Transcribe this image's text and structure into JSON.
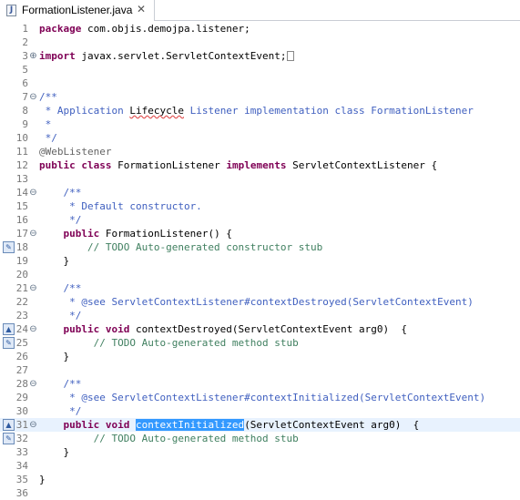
{
  "tab": {
    "title": "FormationListener.java",
    "close": "✕"
  },
  "lines": [
    {
      "n": "1",
      "marker": "",
      "code": [
        [
          "k",
          "package"
        ],
        [
          "t",
          " com.objis.demojpa.listener;"
        ]
      ]
    },
    {
      "n": "2",
      "marker": "",
      "code": []
    },
    {
      "n": "3",
      "marker": "fold-expand",
      "code": [
        [
          "k",
          "import"
        ],
        [
          "t",
          " javax.servlet.ServletContextEvent;"
        ],
        [
          "box",
          ""
        ]
      ]
    },
    {
      "n": "5",
      "marker": "",
      "code": []
    },
    {
      "n": "6",
      "marker": "",
      "code": []
    },
    {
      "n": "7",
      "marker": "fold-collapse",
      "code": [
        [
          "c",
          "/**"
        ]
      ]
    },
    {
      "n": "8",
      "marker": "",
      "code": [
        [
          "c",
          " * Application "
        ],
        [
          "sq",
          "Lifecycle"
        ],
        [
          "c",
          " Listener implementation class FormationListener"
        ]
      ]
    },
    {
      "n": "9",
      "marker": "",
      "code": [
        [
          "c",
          " *"
        ]
      ]
    },
    {
      "n": "10",
      "marker": "",
      "code": [
        [
          "c",
          " */"
        ]
      ]
    },
    {
      "n": "11",
      "marker": "",
      "code": [
        [
          "an",
          "@WebListener"
        ]
      ]
    },
    {
      "n": "12",
      "marker": "",
      "code": [
        [
          "k",
          "public class"
        ],
        [
          "t",
          " FormationListener "
        ],
        [
          "k",
          "implements"
        ],
        [
          "t",
          " ServletContextListener {"
        ]
      ]
    },
    {
      "n": "13",
      "marker": "",
      "code": []
    },
    {
      "n": "14",
      "marker": "fold-collapse",
      "code": [
        [
          "c",
          "    /**"
        ]
      ]
    },
    {
      "n": "15",
      "marker": "",
      "code": [
        [
          "c",
          "     * Default constructor."
        ]
      ]
    },
    {
      "n": "16",
      "marker": "",
      "code": [
        [
          "c",
          "     */"
        ]
      ]
    },
    {
      "n": "17",
      "marker": "fold-collapse",
      "code": [
        [
          "k",
          "    public"
        ],
        [
          "t",
          " FormationListener() {"
        ]
      ]
    },
    {
      "n": "18",
      "marker": "task",
      "code": [
        [
          "cm",
          "        // TODO Auto-generated constructor stub"
        ]
      ]
    },
    {
      "n": "19",
      "marker": "",
      "code": [
        [
          "t",
          "    }"
        ]
      ]
    },
    {
      "n": "20",
      "marker": "",
      "code": []
    },
    {
      "n": "21",
      "marker": "fold-collapse",
      "code": [
        [
          "c",
          "    /**"
        ]
      ]
    },
    {
      "n": "22",
      "marker": "",
      "code": [
        [
          "c",
          "     * @see ServletContextListener#contextDestroyed(ServletContextEvent)"
        ]
      ]
    },
    {
      "n": "23",
      "marker": "",
      "code": [
        [
          "c",
          "     */"
        ]
      ]
    },
    {
      "n": "24",
      "marker": "override-fold",
      "code": [
        [
          "k",
          "    public void"
        ],
        [
          "t",
          " contextDestroyed(ServletContextEvent arg0)  {"
        ]
      ]
    },
    {
      "n": "25",
      "marker": "task",
      "code": [
        [
          "cm",
          "         // TODO Auto-generated method stub"
        ]
      ]
    },
    {
      "n": "26",
      "marker": "",
      "code": [
        [
          "t",
          "    }"
        ]
      ]
    },
    {
      "n": "27",
      "marker": "",
      "code": []
    },
    {
      "n": "28",
      "marker": "fold-collapse",
      "code": [
        [
          "c",
          "    /**"
        ]
      ]
    },
    {
      "n": "29",
      "marker": "",
      "code": [
        [
          "c",
          "     * @see ServletContextListener#contextInitialized(ServletContextEvent)"
        ]
      ]
    },
    {
      "n": "30",
      "marker": "",
      "code": [
        [
          "c",
          "     */"
        ]
      ]
    },
    {
      "n": "31",
      "marker": "override-fold",
      "highlight": true,
      "code": [
        [
          "k",
          "    public void"
        ],
        [
          "t",
          " "
        ],
        [
          "sel",
          "contextInitialized"
        ],
        [
          "t",
          "(ServletContextEvent arg0)  {"
        ]
      ]
    },
    {
      "n": "32",
      "marker": "task",
      "code": [
        [
          "cm",
          "         // TODO Auto-generated method stub"
        ]
      ]
    },
    {
      "n": "33",
      "marker": "",
      "code": [
        [
          "t",
          "    }"
        ]
      ]
    },
    {
      "n": "34",
      "marker": "",
      "code": []
    },
    {
      "n": "35",
      "marker": "",
      "code": [
        [
          "t",
          "}"
        ]
      ]
    },
    {
      "n": "36",
      "marker": "",
      "code": []
    }
  ]
}
